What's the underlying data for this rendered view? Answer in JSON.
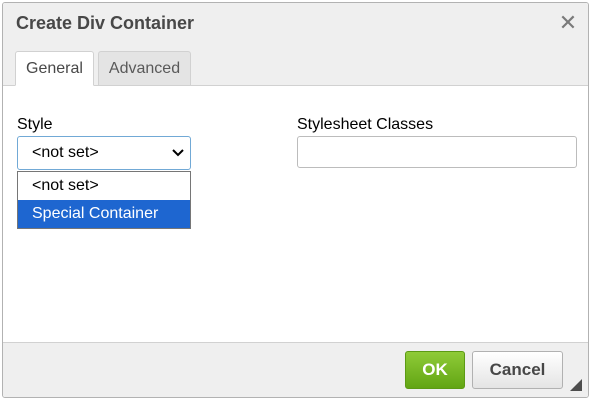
{
  "dialog": {
    "title": "Create Div Container",
    "close_icon": "close-icon"
  },
  "tabs": [
    {
      "label": "General",
      "active": true
    },
    {
      "label": "Advanced",
      "active": false
    }
  ],
  "general": {
    "style_label": "Style",
    "style_value": "<not set>",
    "style_options": [
      {
        "label": "<not set>",
        "highlighted": false
      },
      {
        "label": "Special Container",
        "highlighted": true
      }
    ],
    "classes_label": "Stylesheet Classes",
    "classes_value": ""
  },
  "footer": {
    "ok_label": "OK",
    "cancel_label": "Cancel"
  },
  "colors": {
    "ok_button": "#6cb320",
    "highlight": "#1e66d0"
  }
}
